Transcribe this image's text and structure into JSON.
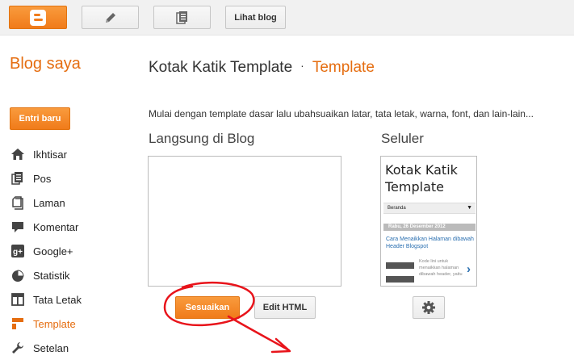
{
  "topbar": {
    "view_blog_label": "Lihat blog"
  },
  "sidebar": {
    "brand": "Blog saya",
    "new_post_label": "Entri baru",
    "items": [
      {
        "label": "Ikhtisar",
        "icon": "home-icon"
      },
      {
        "label": "Pos",
        "icon": "posts-icon"
      },
      {
        "label": "Laman",
        "icon": "pages-icon"
      },
      {
        "label": "Komentar",
        "icon": "comment-icon"
      },
      {
        "label": "Google+",
        "icon": "google-plus-icon"
      },
      {
        "label": "Statistik",
        "icon": "pie-chart-icon"
      },
      {
        "label": "Tata Letak",
        "icon": "layout-icon"
      },
      {
        "label": "Template",
        "icon": "template-icon",
        "active": true
      },
      {
        "label": "Setelan",
        "icon": "wrench-icon"
      }
    ]
  },
  "header": {
    "blog_name": "Kotak Katik Template",
    "separator": "·",
    "current_page": "Template"
  },
  "main": {
    "description": "Mulai dengan template dasar lalu ubahsuaikan latar, tata letak, warna, font, dan lain-lain...",
    "live_title": "Langsung di Blog",
    "mobile_title": "Seluler",
    "customize_label": "Sesuaikan",
    "edit_html_label": "Edit HTML"
  },
  "mobile_preview": {
    "blog_title": "Kotak Katik Template",
    "menu_item": "Beranda",
    "menu_arrow": "▼",
    "date": "Rabu, 26 Desember 2012",
    "post_title": "Cara Menaikkan Halaman dibawah Header Blogspot",
    "snippet": "Kode lini untuk menaikkan halaman dibawah header, yaitu",
    "chevron": "›"
  },
  "colors": {
    "accent": "#e56d10",
    "button_orange": "#f07b1a",
    "annotation_red": "#e8141b"
  }
}
